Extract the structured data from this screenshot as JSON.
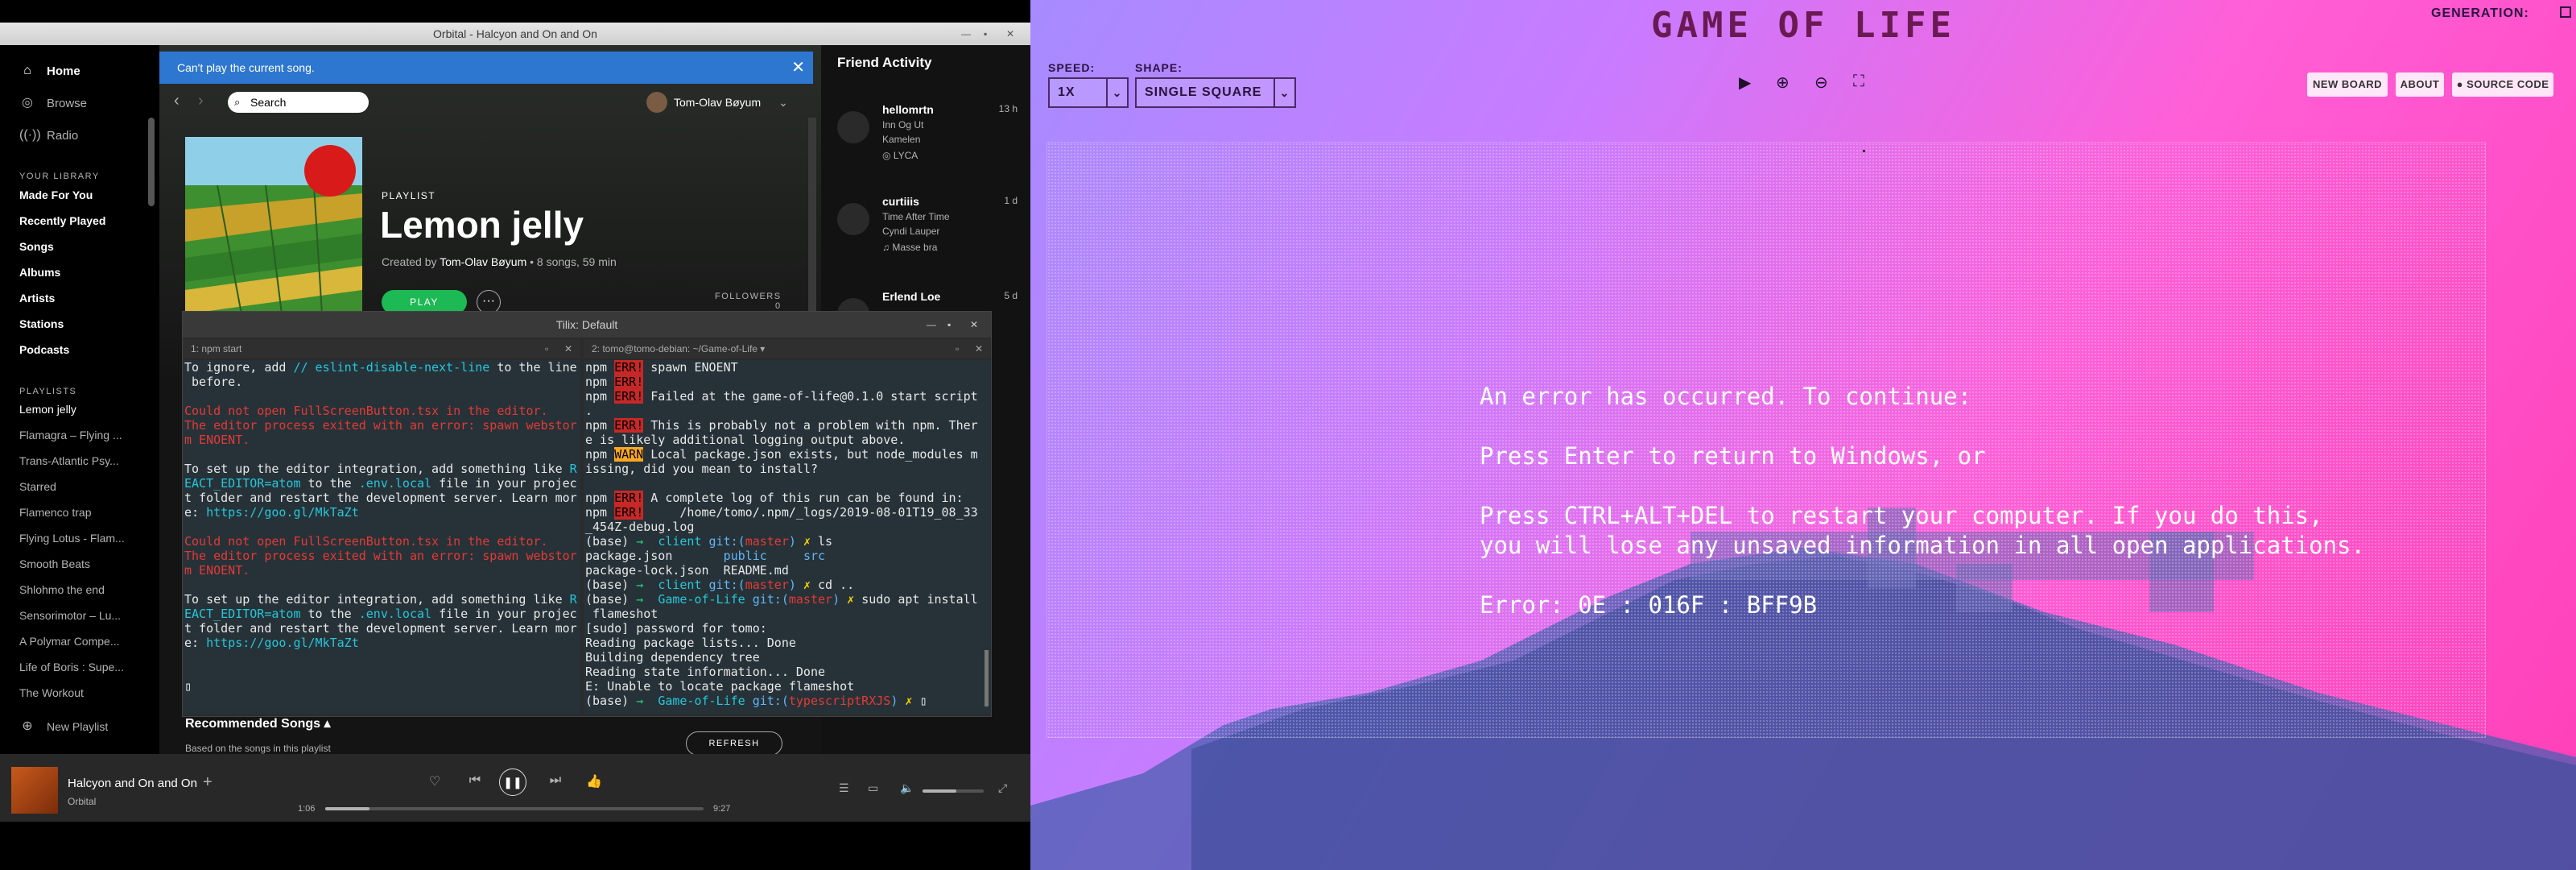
{
  "spotify": {
    "window_title": "Orbital - Halcyon and On and On",
    "nav": [
      "Home",
      "Browse",
      "Radio"
    ],
    "library_heading": "YOUR LIBRARY",
    "library": [
      "Made For You",
      "Recently Played",
      "Songs",
      "Albums",
      "Artists",
      "Stations",
      "Podcasts"
    ],
    "playlists_heading": "PLAYLISTS",
    "playlists": [
      "Lemon jelly",
      "Flamagra – Flying ...",
      "Trans-Atlantic Psy...",
      "Starred",
      "Flamenco trap",
      "Flying Lotus - Flam...",
      "Smooth Beats",
      "Shlohmo the end",
      "Sensorimotor – Lu...",
      "A Polymar Compe...",
      "Life of Boris : Supe...",
      "The Workout"
    ],
    "new_playlist": "New Playlist",
    "banner": "Can't play the current song.",
    "search_placeholder": "Search",
    "user": "Tom-Olav Bøyum",
    "playlist": {
      "type": "PLAYLIST",
      "title": "Lemon jelly",
      "created_by_prefix": "Created by",
      "owner": "Tom-Olav Bøyum",
      "stats": " • 8 songs, 59 min",
      "play": "PLAY",
      "followers_label": "FOLLOWERS",
      "followers": "0"
    },
    "recommended_title": "Recommended Songs",
    "recommended_sub": "Based on the songs in this playlist",
    "refresh": "REFRESH",
    "friend_heading": "Friend Activity",
    "friends": [
      {
        "name": "hellomrtn",
        "time": "13 h",
        "track": "Inn Og Ut",
        "artist": "Kamelen",
        "context": "LYCA"
      },
      {
        "name": "curtiiis",
        "time": "1 d",
        "track": "Time After Time",
        "artist": "Cyndi Lauper",
        "context": "Masse bra"
      },
      {
        "name": "Erlend Loe",
        "time": "5 d",
        "track": "",
        "artist": "",
        "context": ""
      }
    ],
    "now_playing": {
      "title": "Halcyon and On and On",
      "artist": "Orbital",
      "elapsed": "1:06",
      "total": "9:27",
      "progress": 0.117,
      "volume": 0.55
    }
  },
  "tilix": {
    "title": "Tilix: Default",
    "pane1_title": "1: npm start",
    "pane2_title": "2: tomo@tomo-debian: ~/Game-of-Life",
    "pane1_lines": [
      [
        {
          "t": "To ignore, add ",
          "c": ""
        },
        {
          "t": "// eslint-disable-next-line",
          "c": "cy"
        },
        {
          "t": " to the line",
          "c": ""
        }
      ],
      [
        {
          "t": " before.",
          "c": ""
        }
      ],
      [
        {
          "t": "",
          "c": ""
        }
      ],
      [
        {
          "t": "Could not open FullScreenButton.tsx in the editor.",
          "c": "red"
        }
      ],
      [
        {
          "t": "The editor process exited with an error: spawn webstor",
          "c": "red"
        }
      ],
      [
        {
          "t": "m ENOENT.",
          "c": "red"
        }
      ],
      [
        {
          "t": "",
          "c": ""
        }
      ],
      [
        {
          "t": "To set up the editor integration, add something like ",
          "c": ""
        },
        {
          "t": "R",
          "c": "cy"
        }
      ],
      [
        {
          "t": "EACT_EDITOR=atom",
          "c": "cy"
        },
        {
          "t": " to the ",
          "c": ""
        },
        {
          "t": ".env.local",
          "c": "cy"
        },
        {
          "t": " file in your projec",
          "c": ""
        }
      ],
      [
        {
          "t": "t folder and restart the development server. Learn mor",
          "c": ""
        }
      ],
      [
        {
          "t": "e: ",
          "c": ""
        },
        {
          "t": "https://goo.gl/MkTaZt",
          "c": "cy"
        }
      ],
      [
        {
          "t": "",
          "c": ""
        }
      ],
      [
        {
          "t": "Could not open FullScreenButton.tsx in the editor.",
          "c": "red"
        }
      ],
      [
        {
          "t": "The editor process exited with an error: spawn webstor",
          "c": "red"
        }
      ],
      [
        {
          "t": "m ENOENT.",
          "c": "red"
        }
      ],
      [
        {
          "t": "",
          "c": ""
        }
      ],
      [
        {
          "t": "To set up the editor integration, add something like ",
          "c": ""
        },
        {
          "t": "R",
          "c": "cy"
        }
      ],
      [
        {
          "t": "EACT_EDITOR=atom",
          "c": "cy"
        },
        {
          "t": " to the ",
          "c": ""
        },
        {
          "t": ".env.local",
          "c": "cy"
        },
        {
          "t": " file in your projec",
          "c": ""
        }
      ],
      [
        {
          "t": "t folder and restart the development server. Learn mor",
          "c": ""
        }
      ],
      [
        {
          "t": "e: ",
          "c": ""
        },
        {
          "t": "https://goo.gl/MkTaZt",
          "c": "cy"
        }
      ],
      [
        {
          "t": "",
          "c": ""
        }
      ],
      [
        {
          "t": "",
          "c": ""
        }
      ],
      [
        {
          "t": "▯",
          "c": "wht"
        }
      ]
    ],
    "pane2_lines": [
      [
        {
          "t": "npm ",
          "c": ""
        },
        {
          "t": "ERR!",
          "c": "npmerr"
        },
        {
          "t": " spawn ENOENT",
          "c": ""
        }
      ],
      [
        {
          "t": "npm ",
          "c": ""
        },
        {
          "t": "ERR!",
          "c": "npmerr"
        }
      ],
      [
        {
          "t": "npm ",
          "c": ""
        },
        {
          "t": "ERR!",
          "c": "npmerr"
        },
        {
          "t": " Failed at the game-of-life@0.1.0 start script",
          "c": ""
        }
      ],
      [
        {
          "t": ".",
          "c": ""
        }
      ],
      [
        {
          "t": "npm ",
          "c": ""
        },
        {
          "t": "ERR!",
          "c": "npmerr"
        },
        {
          "t": " This is probably not a problem with npm. Ther",
          "c": ""
        }
      ],
      [
        {
          "t": "e is likely additional logging output above.",
          "c": ""
        }
      ],
      [
        {
          "t": "npm ",
          "c": ""
        },
        {
          "t": "WARN",
          "c": "npmwarn"
        },
        {
          "t": " Local package.json exists, but node_modules m",
          "c": ""
        }
      ],
      [
        {
          "t": "issing, did you mean to install?",
          "c": ""
        }
      ],
      [
        {
          "t": "",
          "c": ""
        }
      ],
      [
        {
          "t": "npm ",
          "c": ""
        },
        {
          "t": "ERR!",
          "c": "npmerr"
        },
        {
          "t": " A complete log of this run can be found in:",
          "c": ""
        }
      ],
      [
        {
          "t": "npm ",
          "c": ""
        },
        {
          "t": "ERR!",
          "c": "npmerr"
        },
        {
          "t": "     /home/tomo/.npm/_logs/2019-08-01T19_08_33",
          "c": ""
        }
      ],
      [
        {
          "t": "_454Z-debug.log",
          "c": ""
        }
      ],
      [
        {
          "t": "(base) ",
          "c": ""
        },
        {
          "t": "→  ",
          "c": "grn"
        },
        {
          "t": "client ",
          "c": "cy"
        },
        {
          "t": "git:(",
          "c": "blu"
        },
        {
          "t": "master",
          "c": "red"
        },
        {
          "t": ") ",
          "c": "blu"
        },
        {
          "t": "✗ ",
          "c": "yel"
        },
        {
          "t": "ls",
          "c": ""
        }
      ],
      [
        {
          "t": "package.json       ",
          "c": ""
        },
        {
          "t": "public",
          "c": "blu"
        },
        {
          "t": "     ",
          "c": ""
        },
        {
          "t": "src",
          "c": "blu"
        }
      ],
      [
        {
          "t": "package-lock.json  README.md",
          "c": ""
        }
      ],
      [
        {
          "t": "(base) ",
          "c": ""
        },
        {
          "t": "→  ",
          "c": "grn"
        },
        {
          "t": "client ",
          "c": "cy"
        },
        {
          "t": "git:(",
          "c": "blu"
        },
        {
          "t": "master",
          "c": "red"
        },
        {
          "t": ") ",
          "c": "blu"
        },
        {
          "t": "✗ ",
          "c": "yel"
        },
        {
          "t": "cd ..",
          "c": ""
        }
      ],
      [
        {
          "t": "(base) ",
          "c": ""
        },
        {
          "t": "→  ",
          "c": "grn"
        },
        {
          "t": "Game-of-Life ",
          "c": "cy"
        },
        {
          "t": "git:(",
          "c": "blu"
        },
        {
          "t": "master",
          "c": "red"
        },
        {
          "t": ") ",
          "c": "blu"
        },
        {
          "t": "✗ ",
          "c": "yel"
        },
        {
          "t": "sudo apt install",
          "c": ""
        }
      ],
      [
        {
          "t": " flameshot",
          "c": ""
        }
      ],
      [
        {
          "t": "[sudo] password for tomo:",
          "c": ""
        }
      ],
      [
        {
          "t": "Reading package lists... Done",
          "c": ""
        }
      ],
      [
        {
          "t": "Building dependency tree",
          "c": ""
        }
      ],
      [
        {
          "t": "Reading state information... Done",
          "c": ""
        }
      ],
      [
        {
          "t": "E: Unable to locate package flameshot",
          "c": ""
        }
      ],
      [
        {
          "t": "(base) ",
          "c": ""
        },
        {
          "t": "→  ",
          "c": "grn"
        },
        {
          "t": "Game-of-Life ",
          "c": "cy"
        },
        {
          "t": "git:(",
          "c": "blu"
        },
        {
          "t": "typescriptRXJS",
          "c": "red"
        },
        {
          "t": ") ",
          "c": "blu"
        },
        {
          "t": "✗ ",
          "c": "yel"
        },
        {
          "t": "▯",
          "c": "wht"
        }
      ]
    ]
  },
  "gol": {
    "title": "GAME OF LIFE",
    "generation_label": "GENERATION:",
    "speed_label": "SPEED:",
    "speed_value": "1X",
    "shape_label": "SHAPE:",
    "shape_value": "SINGLE SQUARE",
    "new_board": "NEW BOARD",
    "about": "ABOUT",
    "source_code": "SOURCE CODE",
    "error_text": "An error has occurred. To continue:\n\nPress Enter to return to Windows, or\n\nPress CTRL+ALT+DEL to restart your computer. If you do this,\nyou will lose any unsaved information in all open applications.\n\nError: 0E : 016F : BFF9B"
  },
  "colors": {
    "spotify_green": "#1db954",
    "banner_blue": "#2e77d0",
    "gol_title": "#6a1a52"
  },
  "icons": [
    "home-icon",
    "browse-icon",
    "radio-icon",
    "search-icon",
    "plus-circle-icon",
    "shuffle-icon",
    "prev-icon",
    "pause-icon",
    "next-icon",
    "repeat-icon",
    "queue-icon",
    "devices-icon",
    "volume-icon",
    "fullscreen-icon",
    "play-icon",
    "zoom-in-icon",
    "zoom-out-icon",
    "fit-icon",
    "github-icon"
  ]
}
